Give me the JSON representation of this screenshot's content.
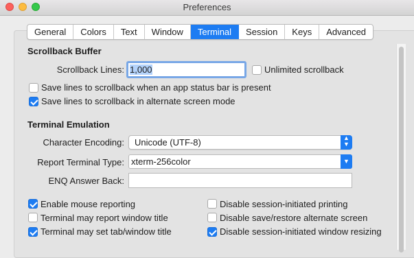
{
  "window": {
    "title": "Preferences"
  },
  "tabs": [
    {
      "label": "General"
    },
    {
      "label": "Colors"
    },
    {
      "label": "Text"
    },
    {
      "label": "Window"
    },
    {
      "label": "Terminal",
      "active": true
    },
    {
      "label": "Session"
    },
    {
      "label": "Keys"
    },
    {
      "label": "Advanced"
    }
  ],
  "scrollback": {
    "heading": "Scrollback Buffer",
    "lines_label": "Scrollback Lines:",
    "lines_value": "1,000",
    "unlimited": {
      "label": "Unlimited scrollback",
      "checked": false
    },
    "save_status_bar": {
      "label": "Save lines to scrollback when an app status bar is present",
      "checked": false
    },
    "save_alternate": {
      "label": "Save lines to scrollback in alternate screen mode",
      "checked": true
    }
  },
  "emulation": {
    "heading": "Terminal Emulation",
    "encoding_label": "Character Encoding:",
    "encoding_value": "Unicode (UTF-8)",
    "type_label": "Report Terminal Type:",
    "type_value": "xterm-256color",
    "enq_label": "ENQ Answer Back:",
    "enq_value": ""
  },
  "options": {
    "mouse_reporting": {
      "label": "Enable mouse reporting",
      "checked": true
    },
    "report_title": {
      "label": "Terminal may report window title",
      "checked": false
    },
    "set_title": {
      "label": "Terminal may set tab/window title",
      "checked": true
    },
    "disable_printing": {
      "label": "Disable session-initiated printing",
      "checked": false
    },
    "disable_save_restore": {
      "label": "Disable save/restore alternate screen",
      "checked": false
    },
    "disable_resizing": {
      "label": "Disable session-initiated window resizing",
      "checked": true
    }
  },
  "colors": {
    "accent": "#1d7cf2",
    "focus_ring": "#78a7e6"
  }
}
